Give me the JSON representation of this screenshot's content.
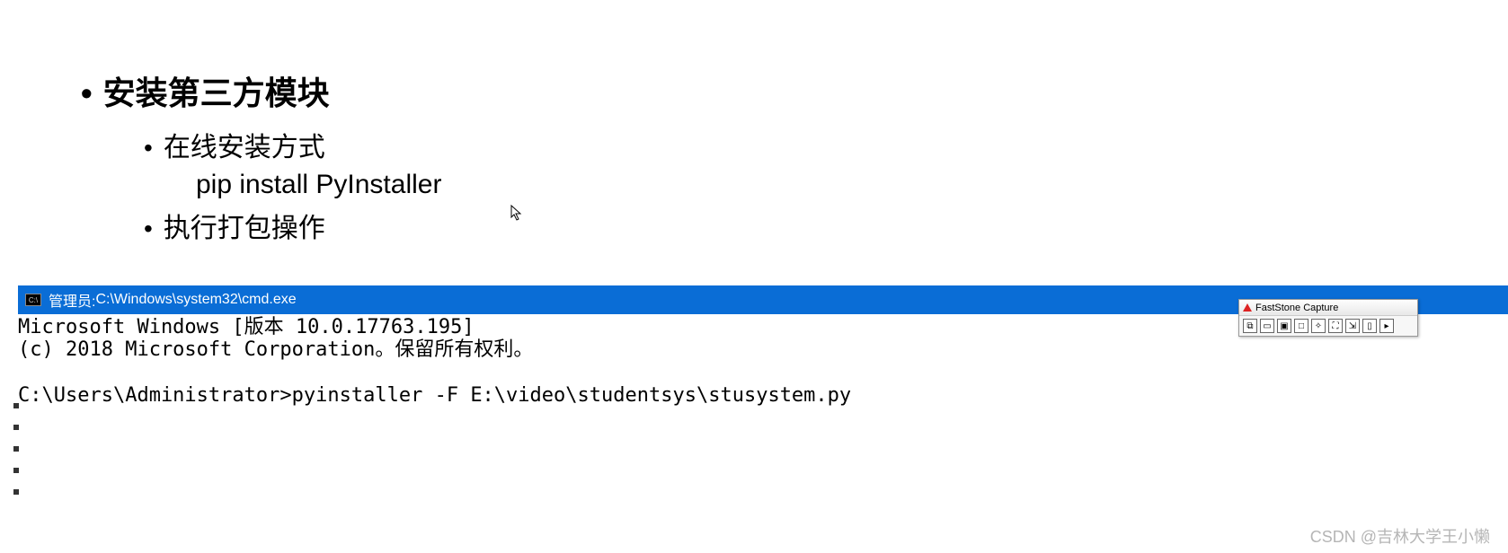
{
  "content": {
    "heading": "安装第三方模块",
    "sub1": "在线安装方式",
    "code": "pip install PyInstaller",
    "sub2": "执行打包操作"
  },
  "cmd": {
    "title_prefix": "管理员: ",
    "title_path": "C:\\Windows\\system32\\cmd.exe",
    "line1": "Microsoft Windows [版本 10.0.17763.195]",
    "line2": "(c) 2018 Microsoft Corporation。保留所有权利。",
    "blank": "",
    "prompt_line": "C:\\Users\\Administrator>pyinstaller -F E:\\video\\studentsys\\stusystem.py"
  },
  "faststone": {
    "title": "FastStone Capture"
  },
  "watermark": "CSDN @吉林大学王小懒"
}
